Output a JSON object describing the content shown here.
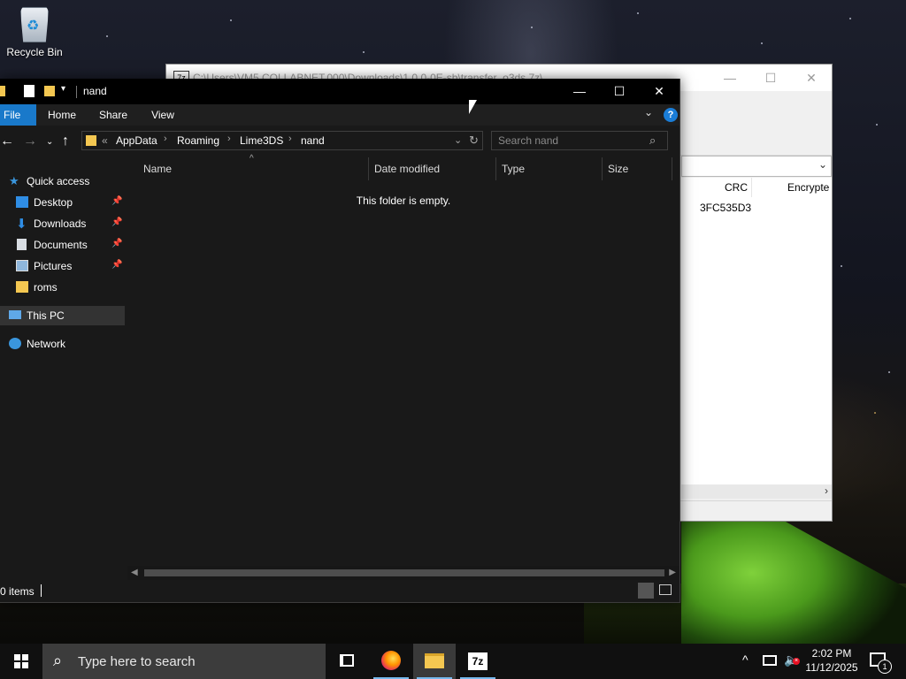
{
  "desktop": {
    "recycle_bin_label": "Recycle Bin"
  },
  "sevenzip_window": {
    "title": "C:\\Users\\VM5.COLLABNET.000\\Downloads\\1.0.0-0E-sb\\transfer_o3ds.7z\\",
    "app_icon": "7z",
    "columns": [
      "CRC",
      "Encrypte"
    ],
    "rows": [
      [
        "3FC535D3",
        ""
      ]
    ]
  },
  "explorer": {
    "title": "nand",
    "ribbon_tabs": [
      "File",
      "Home",
      "Share",
      "View"
    ],
    "help_label": "?",
    "breadcrumb": [
      "AppData",
      "Roaming",
      "Lime3DS",
      "nand"
    ],
    "breadcrumb_overflow": "«",
    "search_placeholder": "Search nand",
    "nav": [
      {
        "label": "Quick access",
        "icon": "star-icon"
      },
      {
        "label": "Desktop",
        "icon": "desktop-icon",
        "pinned": true
      },
      {
        "label": "Downloads",
        "icon": "download-arrow-icon",
        "pinned": true
      },
      {
        "label": "Documents",
        "icon": "document-icon",
        "pinned": true
      },
      {
        "label": "Pictures",
        "icon": "pictures-icon",
        "pinned": true
      },
      {
        "label": "roms",
        "icon": "folder-icon"
      },
      {
        "label": "This PC",
        "icon": "computer-icon",
        "selected": true
      },
      {
        "label": "Network",
        "icon": "network-icon"
      }
    ],
    "columns": [
      "Name",
      "Date modified",
      "Type",
      "Size"
    ],
    "empty_message": "This folder is empty.",
    "status_count": "0 items"
  },
  "taskbar": {
    "search_placeholder": "Type here to search",
    "sevenzip_label": "7z",
    "time": "2:02 PM",
    "date": "11/12/2025",
    "notification_count": "1"
  },
  "colors": {
    "accent": "#1979ca",
    "folder": "#f4c751",
    "taskbar": "#101010",
    "explorer_bg": "#191919"
  }
}
